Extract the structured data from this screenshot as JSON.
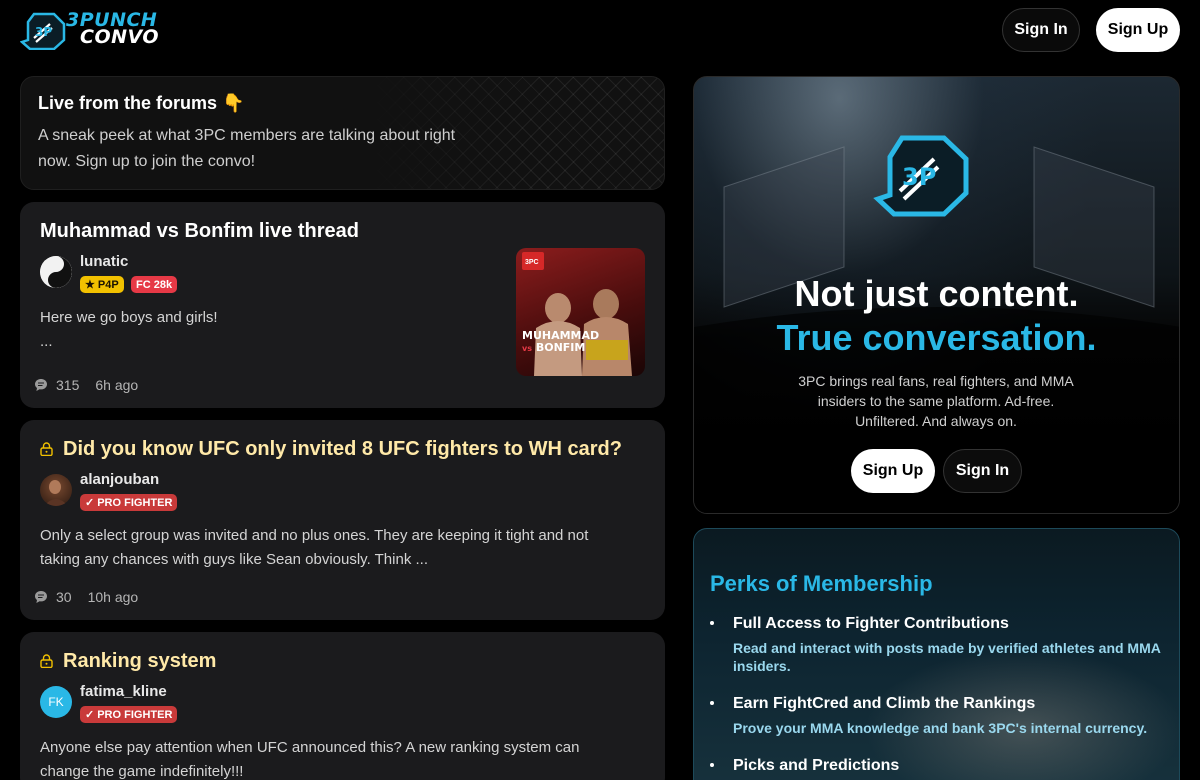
{
  "brand": {
    "line1": "3PUNCH",
    "line2": "CONVO",
    "accent_color": "#2ab8e6"
  },
  "header": {
    "signin_label": "Sign In",
    "signup_label": "Sign Up"
  },
  "banner": {
    "title": "Live from the forums 👇",
    "subtitle": "A sneak peek at what 3PC members are talking about right now. Sign up to join the convo!"
  },
  "posts": [
    {
      "title": "Muhammad vs Bonfim live thread",
      "locked": false,
      "username": "lunatic",
      "badges": [
        "P4P",
        "FC 28k"
      ],
      "excerpt_line1": "Here we go boys and girls!",
      "excerpt_line2": "...",
      "comments": "315",
      "time": "6h ago",
      "thumbnail": {
        "name1": "MUHAMMAD",
        "vs": "vs",
        "name2": "BONFIM"
      }
    },
    {
      "title": "Did you know UFC only invited 8 UFC fighters to WH card?",
      "locked": true,
      "username": "alanjouban",
      "badges": [
        "PRO FIGHTER"
      ],
      "excerpt_line1": "Only a select group was invited and no plus ones. They are keeping it tight and not",
      "excerpt_line2": "taking any chances with guys like Sean obviously. Think ...",
      "comments": "30",
      "time": "10h ago"
    },
    {
      "title": "Ranking system",
      "locked": true,
      "username": "fatima_kline",
      "avatar_initials": "FK",
      "badges": [
        "PRO FIGHTER"
      ],
      "excerpt_line1": "Anyone else pay attention when UFC announced this? A new ranking system can",
      "excerpt_line2": "change the game indefinitely!!!"
    }
  ],
  "promo": {
    "headline1": "Not just content.",
    "headline2": "True conversation.",
    "description": "3PC brings real fans, real fighters, and MMA insiders to the same platform. Ad-free. Unfiltered. And always on.",
    "signup_label": "Sign Up",
    "signin_label": "Sign In"
  },
  "perks": {
    "title": "Perks of Membership",
    "items": [
      {
        "title": "Full Access to Fighter Contributions",
        "desc": "Read and interact with posts made by verified athletes and MMA insiders."
      },
      {
        "title": "Earn FightCred and Climb the Rankings",
        "desc": "Prove your MMA knowledge and bank 3PC's internal currency."
      },
      {
        "title": "Picks and Predictions",
        "desc": ""
      }
    ]
  }
}
